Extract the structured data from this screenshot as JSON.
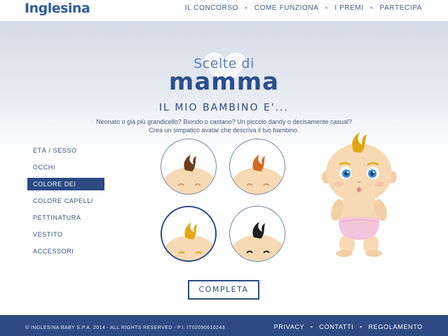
{
  "header": {
    "logo": "Inglesina",
    "nav": [
      {
        "label": "IL CONCORSO"
      },
      {
        "label": "COME FUNZIONA"
      },
      {
        "label": "I PREMI"
      },
      {
        "label": "PARTECIPA"
      }
    ]
  },
  "hero": {
    "brand_line1": "Scelte di",
    "brand_line2": "mamma",
    "title": "IL MIO BAMBINO E'...",
    "description_line1": "Neonato o già più grandicello? Biondo o castano? Un piccolo dandy o decisamente casual?",
    "description_line2": "Crea un simpatico avatar che descriva il tuo bambino."
  },
  "menu": [
    {
      "label": "ETÀ / SESSO",
      "active": false
    },
    {
      "label": "OCCHI",
      "active": false
    },
    {
      "label": "COLORE DEI CAPELLI",
      "active": true
    },
    {
      "label": "COLORE CAPELLI",
      "active": false
    },
    {
      "label": "PETTINATURA",
      "active": false
    },
    {
      "label": "VESTITO",
      "active": false
    },
    {
      "label": "ACCESSORI",
      "active": false
    }
  ],
  "hair_options": [
    {
      "name": "brown",
      "color": "#6b3d1f",
      "selected": false
    },
    {
      "name": "orange",
      "color": "#d46a1e",
      "selected": false
    },
    {
      "name": "blonde",
      "color": "#e0a612",
      "selected": true
    },
    {
      "name": "black",
      "color": "#1e1e1e",
      "selected": false
    }
  ],
  "colors": {
    "primary": "#2d4a82",
    "skin": "#f7d9b3",
    "diaper": "#f4c6dc"
  },
  "complete_button": "COMPLETA",
  "footer": {
    "copyright": "© INGLESINA BABY S.P.A. 2014 - ALL RIGHTS RESERVED - P.I. IT02090610243",
    "links": [
      {
        "label": "PRIVACY"
      },
      {
        "label": "CONTATTI"
      },
      {
        "label": "REGOLAMENTO"
      }
    ]
  }
}
